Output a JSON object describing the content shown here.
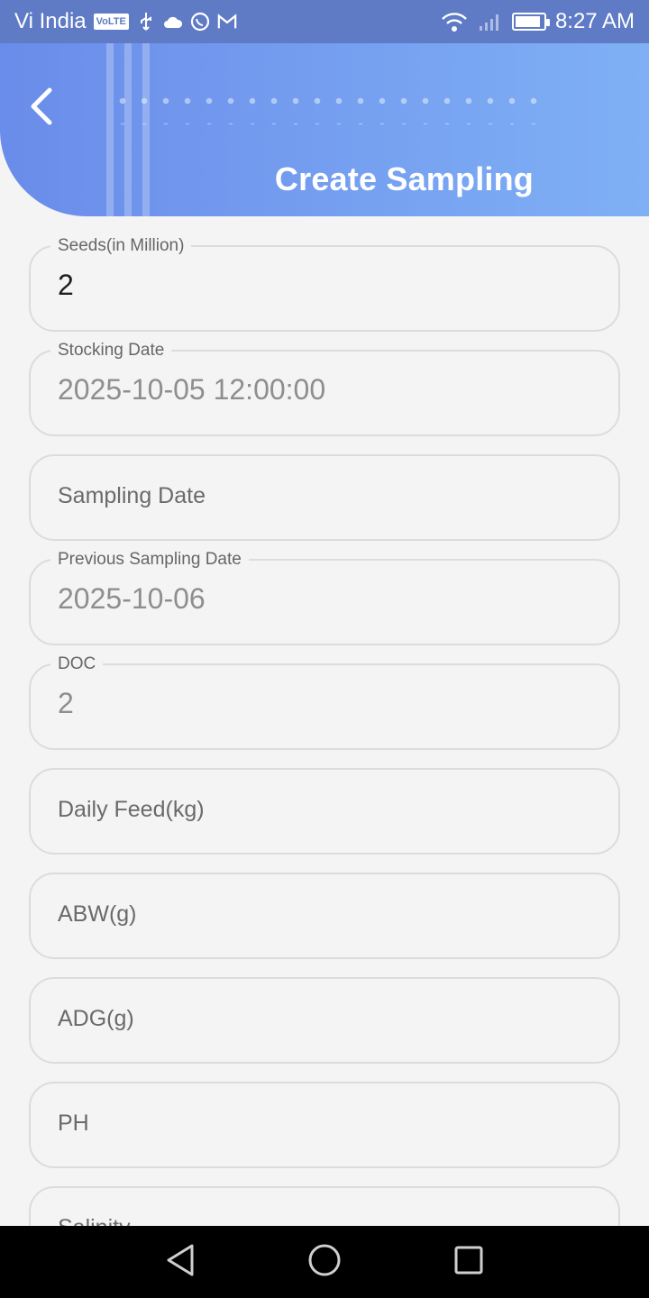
{
  "status_bar": {
    "carrier": "Vi India",
    "volte_badge": "VoLTE",
    "time": "8:27 AM",
    "icons": [
      "usb-icon",
      "cloud-icon",
      "whatsapp-icon",
      "gmail-icon",
      "wifi-icon",
      "signal-icon",
      "battery-icon"
    ],
    "battery_level": 0.9
  },
  "header": {
    "title": "Create Sampling",
    "back_icon": "chevron-left-icon",
    "gradient_start": "#6a8cea",
    "gradient_end": "#7fb0f5"
  },
  "form": {
    "fields": [
      {
        "label": "Seeds(in Million)",
        "value": "2"
      },
      {
        "label": "Stocking Date",
        "value": "2025-10-05 12:00:00"
      },
      {
        "placeholder": "Sampling Date"
      },
      {
        "label": "Previous Sampling Date",
        "value": "2025-10-06"
      },
      {
        "label": "DOC",
        "value": "2"
      },
      {
        "placeholder": "Daily Feed(kg)"
      },
      {
        "placeholder": "ABW(g)"
      },
      {
        "placeholder": "ADG(g)"
      },
      {
        "placeholder": "PH"
      },
      {
        "placeholder": "Salinity"
      }
    ]
  },
  "nav_bar": {
    "icons": [
      "back-triangle-icon",
      "home-circle-icon",
      "recents-square-icon"
    ]
  },
  "colors": {
    "status_bar_bg": "#5f7bc6",
    "page_bg": "#f4f4f4",
    "field_border": "#dcdcdc"
  }
}
